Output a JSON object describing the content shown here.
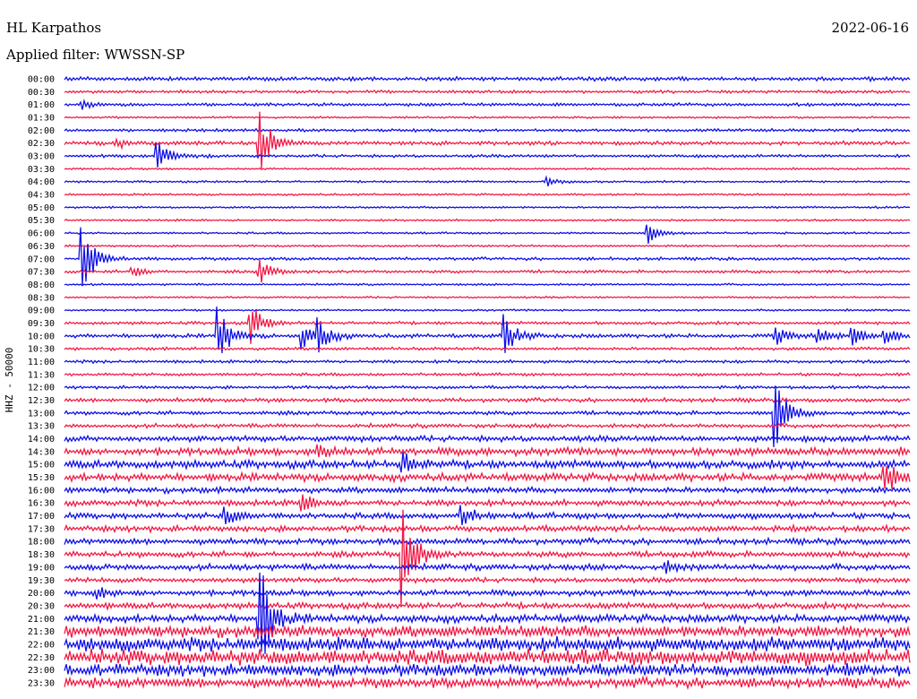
{
  "header": {
    "station": "HL Karpathos",
    "date": "2022-06-16",
    "filter": "Applied filter: WWSSN-SP"
  },
  "colors": {
    "even_rows": "#1010e6",
    "odd_rows": "#f01a46",
    "background": "#ffffff",
    "text": "#000000"
  },
  "chart_data": {
    "type": "line",
    "title": "HL Karpathos",
    "subtitle": "Applied filter: WWSSN-SP",
    "ylabel": "HHZ - 50000",
    "xlabel": "",
    "grid": false,
    "legend": "none",
    "row_labels": [
      "00:00",
      "00:30",
      "01:00",
      "01:30",
      "02:00",
      "02:30",
      "03:00",
      "03:30",
      "04:00",
      "04:30",
      "05:00",
      "05:30",
      "06:00",
      "06:30",
      "07:00",
      "07:30",
      "08:00",
      "08:30",
      "09:00",
      "09:30",
      "10:00",
      "10:30",
      "11:00",
      "11:30",
      "12:00",
      "12:30",
      "13:00",
      "13:30",
      "14:00",
      "14:30",
      "15:00",
      "15:30",
      "16:00",
      "16:30",
      "17:00",
      "17:30",
      "18:00",
      "18:30",
      "19:00",
      "19:30",
      "20:00",
      "20:30",
      "21:00",
      "21:30",
      "22:00",
      "22:30",
      "23:00",
      "23:30"
    ],
    "row_noise": [
      2,
      1.5,
      1.5,
      1,
      1.5,
      2,
      1.5,
      1,
      1,
      1,
      1,
      1,
      1,
      1,
      1.5,
      1.5,
      1,
      1,
      1,
      1.5,
      2,
      1.5,
      1.5,
      1.5,
      1.5,
      2,
      2,
      2,
      3,
      4,
      4,
      4,
      3,
      3,
      3,
      3,
      3,
      3,
      3,
      2.5,
      3,
      3,
      4,
      6,
      7,
      8,
      6,
      5
    ],
    "events": [
      {
        "row": 2,
        "t": 0.02,
        "amp": 5
      },
      {
        "row": 5,
        "t": 0.06,
        "amp": 6
      },
      {
        "row": 5,
        "t": 0.23,
        "amp": 45
      },
      {
        "row": 6,
        "t": 0.11,
        "amp": 18
      },
      {
        "row": 8,
        "t": 0.57,
        "amp": 6
      },
      {
        "row": 12,
        "t": 0.69,
        "amp": 12
      },
      {
        "row": 14,
        "t": 0.02,
        "amp": 45
      },
      {
        "row": 15,
        "t": 0.08,
        "amp": 6
      },
      {
        "row": 15,
        "t": 0.23,
        "amp": 15
      },
      {
        "row": 19,
        "t": 0.22,
        "amp": 25
      },
      {
        "row": 20,
        "t": 0.18,
        "amp": 38
      },
      {
        "row": 20,
        "t": 0.28,
        "amp": 15
      },
      {
        "row": 20,
        "t": 0.3,
        "amp": 18
      },
      {
        "row": 20,
        "t": 0.52,
        "amp": 25
      },
      {
        "row": 20,
        "t": 0.84,
        "amp": 12
      },
      {
        "row": 20,
        "t": 0.89,
        "amp": 12
      },
      {
        "row": 20,
        "t": 0.93,
        "amp": 12
      },
      {
        "row": 20,
        "t": 0.97,
        "amp": 10
      },
      {
        "row": 26,
        "t": 0.84,
        "amp": 45
      },
      {
        "row": 29,
        "t": 0.3,
        "amp": 10
      },
      {
        "row": 30,
        "t": 0.4,
        "amp": 15
      },
      {
        "row": 31,
        "t": 0.97,
        "amp": 20
      },
      {
        "row": 33,
        "t": 0.28,
        "amp": 10
      },
      {
        "row": 34,
        "t": 0.19,
        "amp": 10
      },
      {
        "row": 34,
        "t": 0.47,
        "amp": 12
      },
      {
        "row": 37,
        "t": 0.4,
        "amp": 60
      },
      {
        "row": 38,
        "t": 0.71,
        "amp": 7
      },
      {
        "row": 40,
        "t": 0.04,
        "amp": 6
      },
      {
        "row": 42,
        "t": 0.23,
        "amp": 70
      }
    ]
  }
}
